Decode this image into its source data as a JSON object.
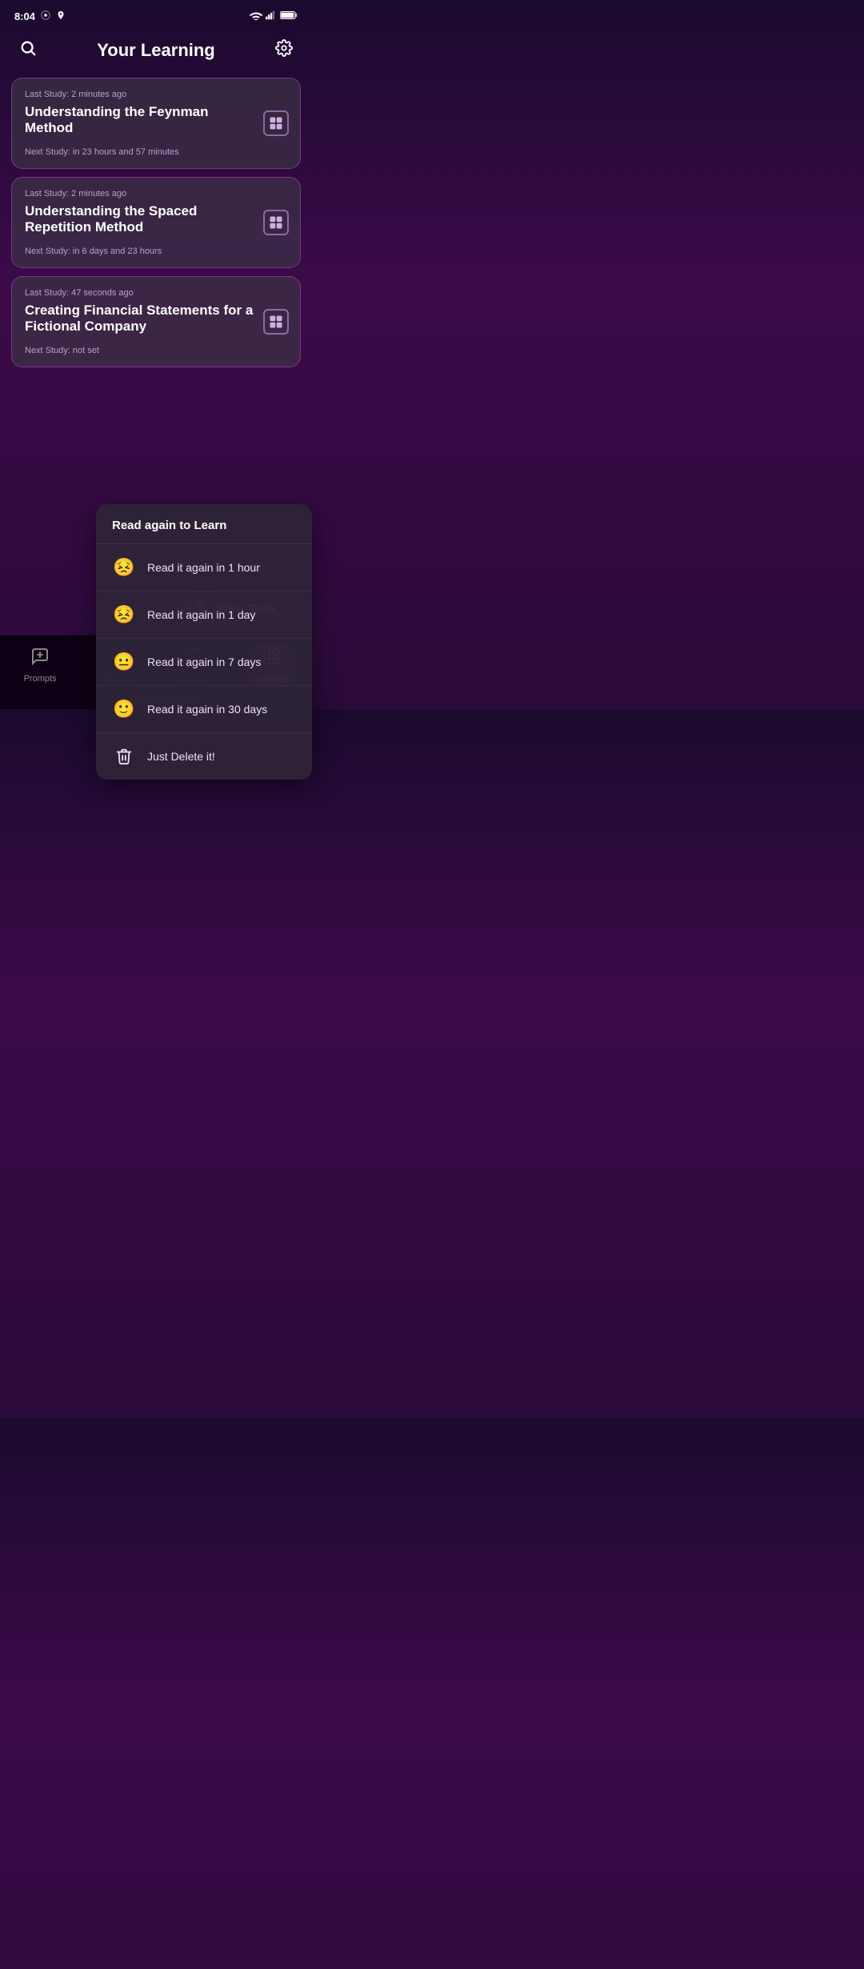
{
  "statusBar": {
    "time": "8:04",
    "icons": [
      "settings",
      "location",
      "wifi",
      "signal",
      "battery"
    ]
  },
  "header": {
    "title": "Your Learning",
    "searchLabel": "search",
    "settingsLabel": "settings"
  },
  "cards": [
    {
      "lastStudy": "Last Study: 2 minutes ago",
      "title": "Understanding the Feynman Method",
      "nextStudy": "Next Study: in 23 hours and 57 minutes"
    },
    {
      "lastStudy": "Last Study: 2 minutes ago",
      "title": "Understanding the Spaced Repetition Method",
      "nextStudy": "Next Study: in 6 days and 23 hours"
    },
    {
      "lastStudy": "Last Study: 47 seconds ago",
      "title": "Creating Financial Statements for a Fictional Company",
      "nextStudy": "Next Study: not set"
    }
  ],
  "dropdown": {
    "header": "Read again to Learn",
    "items": [
      {
        "label": "Read it again in 1 hour",
        "icon": "😣"
      },
      {
        "label": "Read it again in 1 day",
        "icon": "😣"
      },
      {
        "label": "Read it again in 7 days",
        "icon": "😐"
      },
      {
        "label": "Read it again in 30 days",
        "icon": "🙂"
      },
      {
        "label": "Just Delete it!",
        "icon": "🗑️"
      }
    ]
  },
  "newTask": {
    "label": "New Task"
  },
  "bottomNav": {
    "items": [
      {
        "id": "prompts",
        "label": "Prompts",
        "active": false
      },
      {
        "id": "for-you",
        "label": "For You",
        "active": false
      },
      {
        "id": "saved",
        "label": "Saved",
        "active": false
      },
      {
        "id": "learning",
        "label": "Learning",
        "active": true
      }
    ]
  }
}
